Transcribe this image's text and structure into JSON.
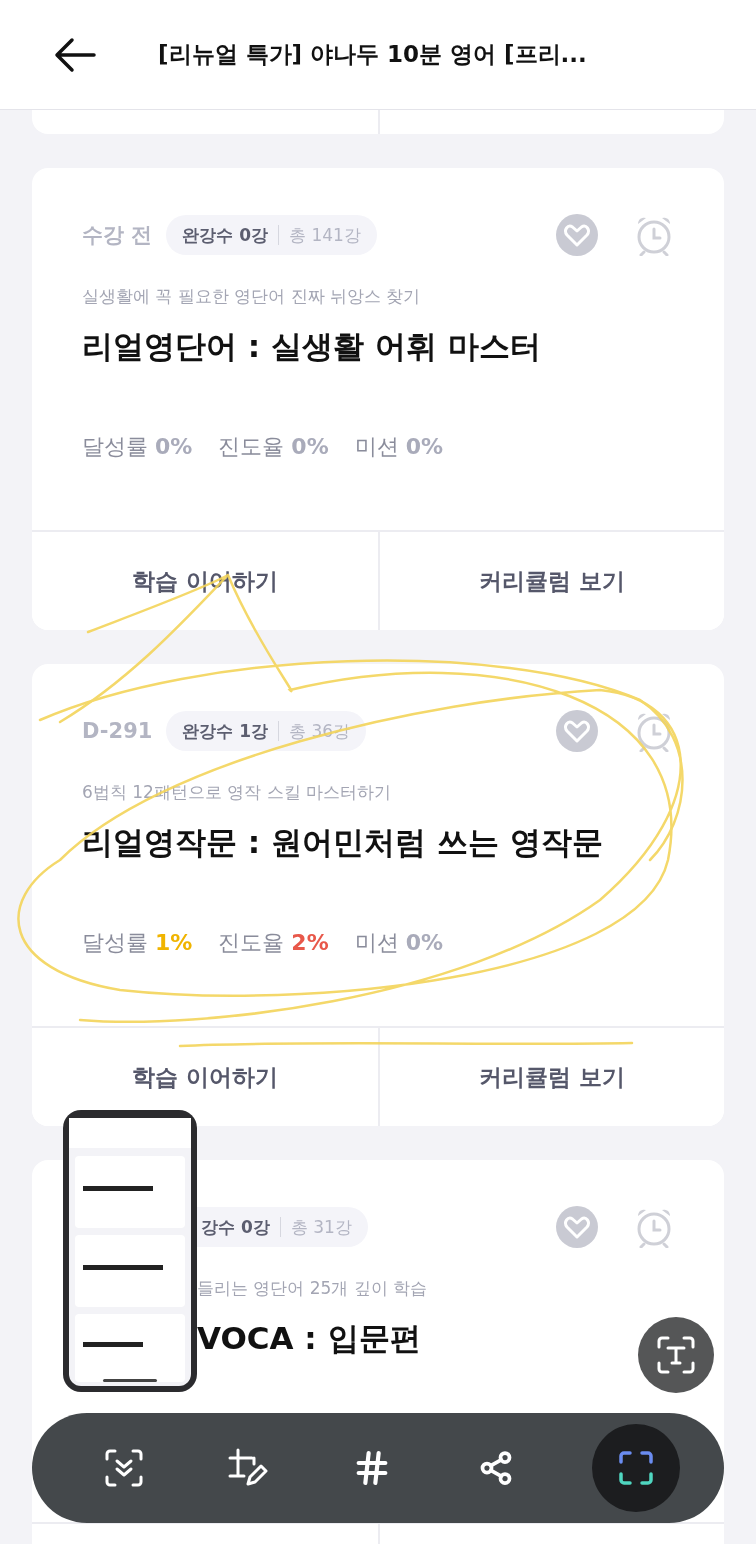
{
  "header": {
    "title": "[리뉴얼 특가] 야나두 10분 영어 [프리..."
  },
  "courses": [
    {
      "kind": "full",
      "status": "수강 전",
      "completed": "완강수 0강",
      "total": "총 141강",
      "subtitle": "실생활에 꼭 필요한 영단어 진짜 뉘앙스 찾기",
      "title": "리얼영단어 : 실생활 어휘 마스터",
      "stats": [
        {
          "label": "달성률",
          "value": "0%",
          "color": "#a9abba"
        },
        {
          "label": "진도율",
          "value": "0%",
          "color": "#a9abba"
        },
        {
          "label": "미션",
          "value": "0%",
          "color": "#a9abba"
        }
      ],
      "buttons": [
        "학습 이어하기",
        "커리큘럼 보기"
      ]
    },
    {
      "kind": "full",
      "status": "D-291",
      "completed": "완강수 1강",
      "total": "총 36강",
      "subtitle": "6법칙 12패턴으로 영작 스킬 마스터하기",
      "title": "리얼영작문 : 원어민처럼 쓰는 영작문",
      "stats": [
        {
          "label": "달성률",
          "value": "1%",
          "color": "#f0b400"
        },
        {
          "label": "진도율",
          "value": "2%",
          "color": "#e8584a"
        },
        {
          "label": "미션",
          "value": "0%",
          "color": "#a9abba"
        }
      ],
      "buttons": [
        "학습 이어하기",
        "커리큘럼 보기"
      ]
    },
    {
      "kind": "covered",
      "completed": "강수 0강",
      "total": "총 31강",
      "subtitle": "들리는 영단어 25개 깊이 학습",
      "title": "VOCA : 입문편"
    }
  ]
}
